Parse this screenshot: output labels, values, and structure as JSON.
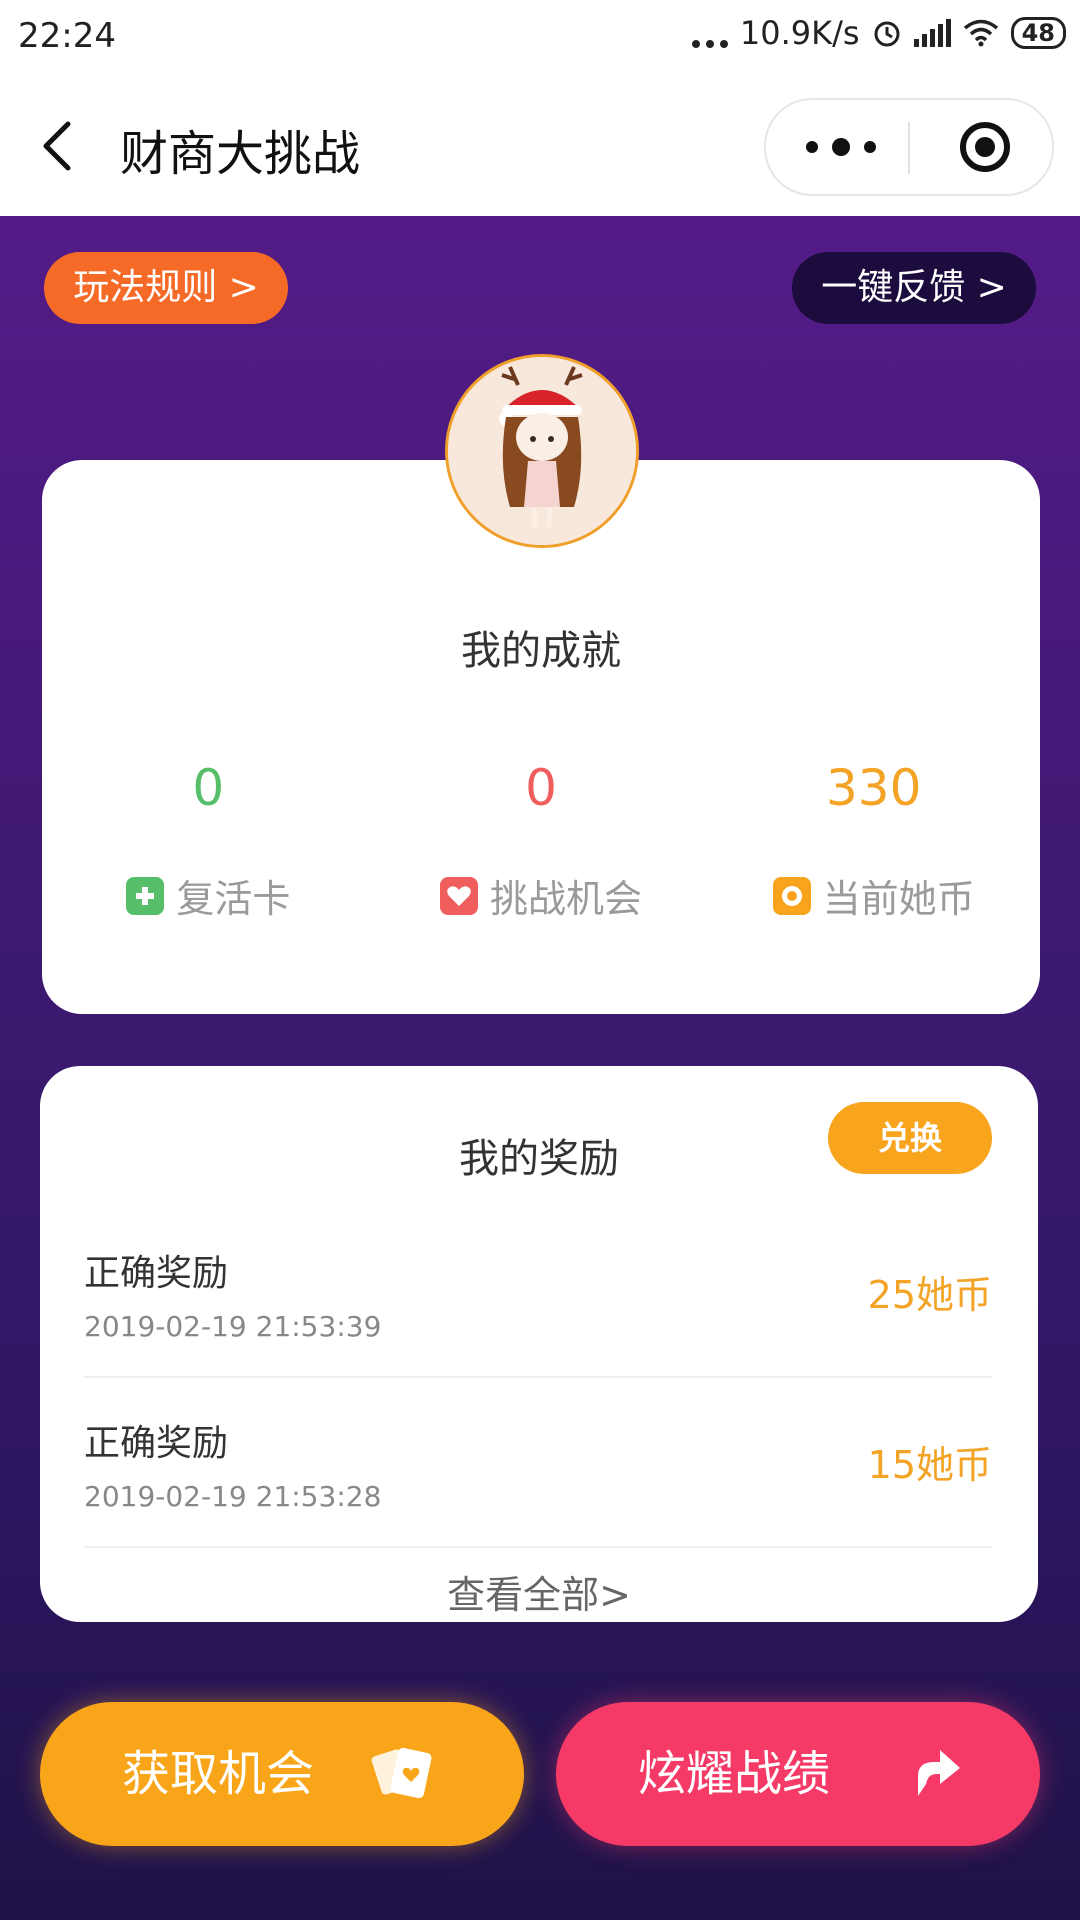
{
  "status_bar": {
    "time": "22:24",
    "net_speed": "10.9K/s",
    "battery": "48"
  },
  "nav": {
    "title": "财商大挑战"
  },
  "header_buttons": {
    "rules": "玩法规则 >",
    "feedback": "一键反馈 >"
  },
  "achievements": {
    "title": "我的成就",
    "stats": [
      {
        "value": "0",
        "label": "复活卡",
        "color": "#57bf6a",
        "icon": "plus-icon"
      },
      {
        "value": "0",
        "label": "挑战机会",
        "color": "#ef5d5d",
        "icon": "heart-icon"
      },
      {
        "value": "330",
        "label": "当前她币",
        "color": "#f3a326",
        "icon": "coin-icon"
      }
    ]
  },
  "rewards": {
    "title": "我的奖励",
    "exchange_label": "兑换",
    "items": [
      {
        "name": "正确奖励",
        "time": "2019-02-19 21:53:39",
        "amount": "25她币"
      },
      {
        "name": "正确奖励",
        "time": "2019-02-19 21:53:28",
        "amount": "15她币"
      }
    ],
    "view_all": "查看全部>"
  },
  "actions": {
    "get_chance": "获取机会",
    "show_off": "炫耀战绩"
  },
  "colors": {
    "orange": "#f66a28",
    "gold": "#f9a51a",
    "pink": "#f63a67",
    "purple_top": "#541b87",
    "purple_bottom": "#1f1347"
  }
}
